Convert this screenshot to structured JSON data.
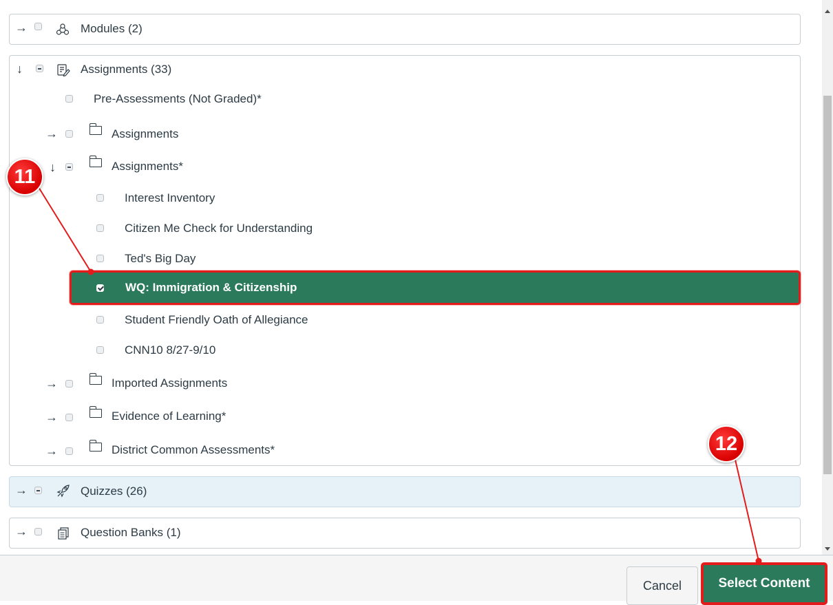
{
  "tree": {
    "modules": {
      "label": "Modules (2)"
    },
    "assignments": {
      "label": "Assignments (33)",
      "children": {
        "pre_assessments": "Pre-Assessments (Not Graded)*",
        "folder_assignments": "Assignments",
        "folder_assignments_star": "Assignments*",
        "items": [
          "Interest Inventory",
          "Citizen Me Check for Understanding",
          "Ted's Big Day",
          "WQ: Immigration & Citizenship",
          "Student Friendly Oath of Allegiance",
          "CNN10 8/27-9/10"
        ],
        "folder_imported": "Imported Assignments",
        "folder_evidence": "Evidence of Learning*",
        "folder_district": "District Common Assessments*"
      }
    },
    "quizzes": {
      "label": "Quizzes (26)"
    },
    "question_banks": {
      "label": "Question Banks (1)"
    }
  },
  "footer": {
    "cancel_label": "Cancel",
    "select_label": "Select Content"
  },
  "annotations": {
    "step_11": "11",
    "step_12": "12"
  },
  "colors": {
    "selected_bg": "#2b7a5b",
    "highlight": "#e41b1b",
    "quizzes_bg": "#e6f1f8"
  }
}
